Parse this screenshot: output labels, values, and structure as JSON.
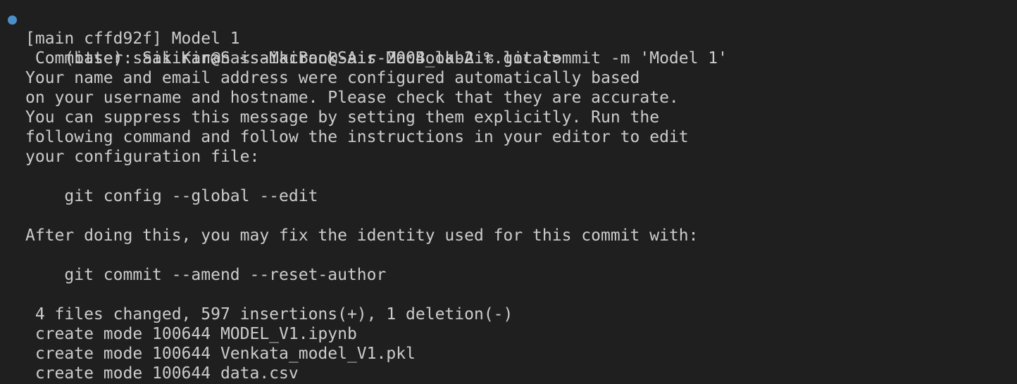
{
  "terminal": {
    "prompt_line": "(base) saikiran@Sais-MacBook-Air 2004_lab2 % git commit -m 'Model 1'",
    "lines": [
      "[main cffd92f] Model 1",
      " Committer: Sai Kiran <saikiran@Sais-MacBook-Air.local>",
      "Your name and email address were configured automatically based",
      "on your username and hostname. Please check that they are accurate.",
      "You can suppress this message by setting them explicitly. Run the",
      "following command and follow the instructions in your editor to edit",
      "your configuration file:",
      "",
      "    git config --global --edit",
      "",
      "After doing this, you may fix the identity used for this commit with:",
      "",
      "    git commit --amend --reset-author",
      "",
      " 4 files changed, 597 insertions(+), 1 deletion(-)",
      " create mode 100644 MODEL_V1.ipynb",
      " create mode 100644 Venkata_model_V1.pkl",
      " create mode 100644 data.csv"
    ],
    "status_dot_color": "#4b8fc9",
    "background_color": "#1f1f1f",
    "text_color": "#cccccc"
  }
}
